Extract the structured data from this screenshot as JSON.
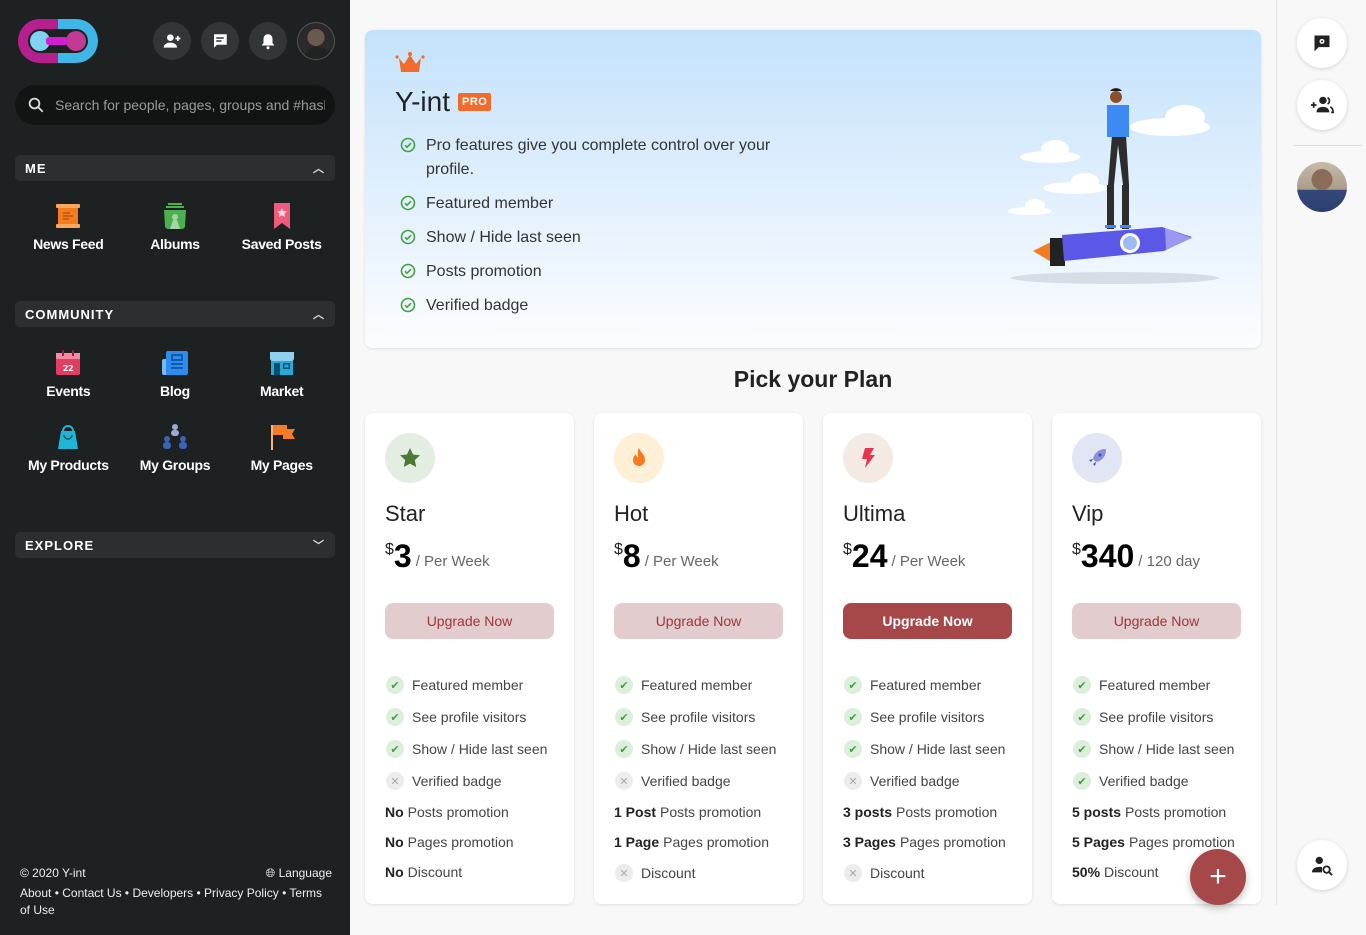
{
  "sidebar": {
    "search": {
      "placeholder": "Search for people, pages, groups and #hashtags"
    },
    "sections": {
      "me": {
        "title": "ME",
        "items": [
          {
            "label": "News Feed",
            "icon": "news-feed-icon",
            "color": "#f47b20"
          },
          {
            "label": "Albums",
            "icon": "albums-icon",
            "color": "#4caf50"
          },
          {
            "label": "Saved Posts",
            "icon": "bookmark-icon",
            "color": "#ef5b7b"
          }
        ]
      },
      "community": {
        "title": "COMMUNITY",
        "items": [
          {
            "label": "Events",
            "icon": "calendar-icon",
            "color": "#e23e63"
          },
          {
            "label": "Blog",
            "icon": "blog-icon",
            "color": "#2d8cf0"
          },
          {
            "label": "Market",
            "icon": "market-icon",
            "color": "#26a8d8"
          },
          {
            "label": "My Products",
            "icon": "shopping-bag-icon",
            "color": "#1fb5d6"
          },
          {
            "label": "My Groups",
            "icon": "groups-icon",
            "color": "#3b63b5"
          },
          {
            "label": "My Pages",
            "icon": "flag-icon",
            "color": "#f57c24"
          }
        ]
      },
      "explore": {
        "title": "EXPLORE"
      }
    },
    "footer": {
      "copyright": "© 2020 Y-int",
      "language": "Language",
      "links": [
        "About",
        "Contact Us",
        "Developers",
        "Privacy Policy",
        "Terms of Use"
      ]
    }
  },
  "hero": {
    "title": "Y-int",
    "badge": "PRO",
    "features": [
      "Pro features give you complete control over your profile.",
      "Featured member",
      "Show / Hide last seen",
      "Posts promotion",
      "Verified badge"
    ]
  },
  "plans_title": "Pick your Plan",
  "plans": [
    {
      "name": "Star",
      "currency": "$",
      "price": "3",
      "period": "/ Per Week",
      "button": "Upgrade Now",
      "icon": "star-icon",
      "icon_color": "#4a7a34",
      "icon_bg": "#e4ede2",
      "features": [
        {
          "label": "Featured member",
          "included": true
        },
        {
          "label": "See profile visitors",
          "included": true
        },
        {
          "label": "Show / Hide last seen",
          "included": true
        },
        {
          "label": "Verified badge",
          "included": false
        }
      ],
      "extras": [
        {
          "value": "No",
          "label": "Posts promotion"
        },
        {
          "value": "No",
          "label": "Pages promotion"
        },
        {
          "value": "No",
          "label": "Discount"
        }
      ]
    },
    {
      "name": "Hot",
      "currency": "$",
      "price": "8",
      "period": "/ Per Week",
      "button": "Upgrade Now",
      "icon": "fire-icon",
      "icon_color": "#f47b20",
      "icon_bg": "#fdf0d6",
      "features": [
        {
          "label": "Featured member",
          "included": true
        },
        {
          "label": "See profile visitors",
          "included": true
        },
        {
          "label": "Show / Hide last seen",
          "included": true
        },
        {
          "label": "Verified badge",
          "included": false
        }
      ],
      "extras": [
        {
          "value": "1 Post",
          "label": "Posts promotion"
        },
        {
          "value": "1 Page",
          "label": "Pages promotion"
        },
        {
          "value": "",
          "label": "Discount",
          "included": false
        }
      ]
    },
    {
      "name": "Ultima",
      "currency": "$",
      "price": "24",
      "period": "/ Per Week",
      "button": "Upgrade Now",
      "icon": "lightning-icon",
      "icon_color": "#e8344e",
      "icon_bg": "#f3ebe3",
      "highlighted": true,
      "features": [
        {
          "label": "Featured member",
          "included": true
        },
        {
          "label": "See profile visitors",
          "included": true
        },
        {
          "label": "Show / Hide last seen",
          "included": true
        },
        {
          "label": "Verified badge",
          "included": false
        }
      ],
      "extras": [
        {
          "value": "3 posts",
          "label": "Posts promotion"
        },
        {
          "value": "3 Pages",
          "label": "Pages promotion"
        },
        {
          "value": "",
          "label": "Discount",
          "included": false
        }
      ]
    },
    {
      "name": "Vip",
      "currency": "$",
      "price": "340",
      "period": "/ 120 day",
      "button": "Upgrade Now",
      "icon": "rocket-icon",
      "icon_color": "#6b74d6",
      "icon_bg": "#e2e6f4",
      "features": [
        {
          "label": "Featured member",
          "included": true
        },
        {
          "label": "See profile visitors",
          "included": true
        },
        {
          "label": "Show / Hide last seen",
          "included": true
        },
        {
          "label": "Verified badge",
          "included": true
        }
      ],
      "extras": [
        {
          "value": "5 posts",
          "label": "Posts promotion"
        },
        {
          "value": "5 Pages",
          "label": "Pages promotion"
        },
        {
          "value": "50%",
          "label": "Discount"
        }
      ]
    }
  ],
  "colors": {
    "accent": "#a6484a",
    "accent_soft": "#e2cccd",
    "sidebar_bg": "#1e2122",
    "check_green": "#3fa33f",
    "pro_orange": "#f26b2c"
  }
}
